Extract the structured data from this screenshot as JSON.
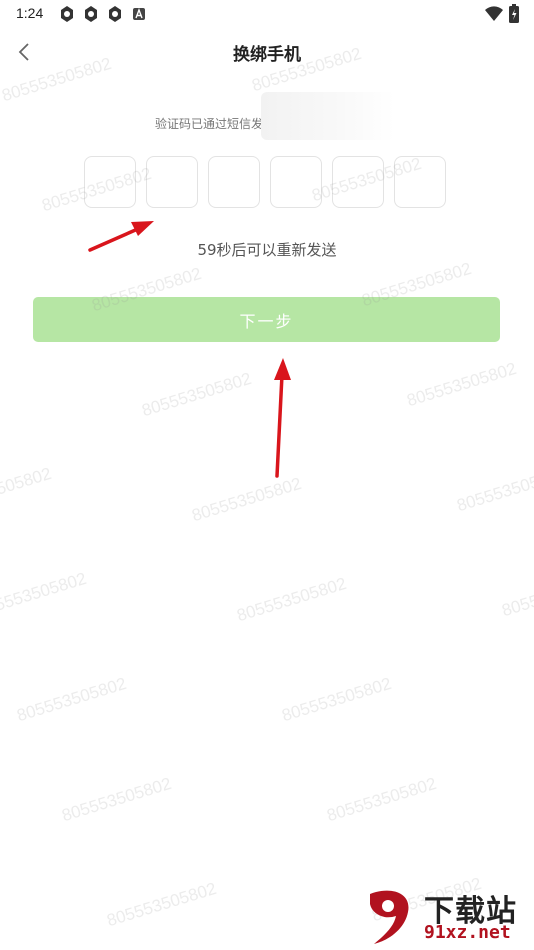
{
  "status_bar": {
    "time": "1:24",
    "icons": [
      "app-notification-icon",
      "app-notification-icon",
      "app-notification-icon",
      "app-a-icon"
    ],
    "right_icons": [
      "wifi-icon",
      "battery-charging-icon"
    ]
  },
  "header": {
    "title": "换绑手机",
    "back_icon": "chevron-left-icon"
  },
  "verify": {
    "hint": "验证码已通过短信发送",
    "code_slots": 6,
    "countdown": "59秒后可以重新发送"
  },
  "actions": {
    "next_label": "下一步",
    "next_color": "#b6e6a4"
  },
  "watermark": {
    "text": "805553505802"
  },
  "logo": {
    "main": "下载站",
    "sub": "91xz.net",
    "accent_color": "#b1121f"
  },
  "colors": {
    "annotation_arrow": "#d9151c"
  }
}
